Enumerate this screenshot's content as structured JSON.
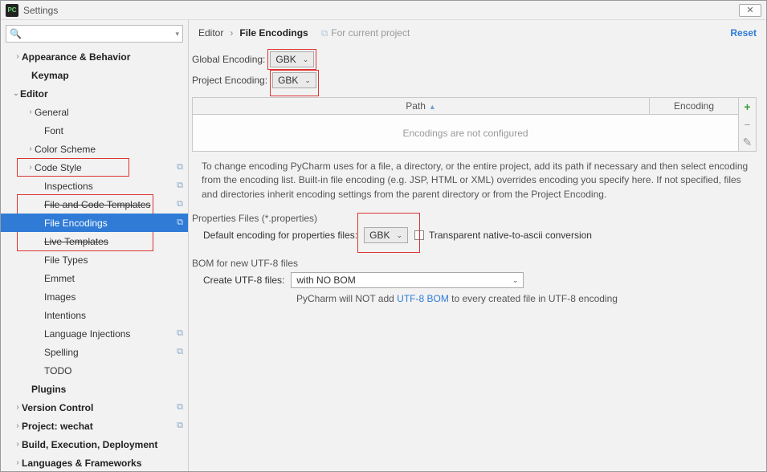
{
  "window": {
    "title": "Settings"
  },
  "sidebar": {
    "search_placeholder": "",
    "items": [
      {
        "label": "Appearance & Behavior",
        "bold": true,
        "arrow": "›",
        "indent": 16
      },
      {
        "label": "Keymap",
        "bold": true,
        "arrow": "",
        "indent": 28
      },
      {
        "label": "Editor",
        "bold": true,
        "arrow": "⌄",
        "indent": 14
      },
      {
        "label": "General",
        "arrow": "›",
        "indent": 32
      },
      {
        "label": "Font",
        "arrow": "",
        "indent": 44
      },
      {
        "label": "Color Scheme",
        "arrow": "›",
        "indent": 32
      },
      {
        "label": "Code Style",
        "arrow": "›",
        "indent": 32,
        "copy": true,
        "red": true
      },
      {
        "label": "Inspections",
        "arrow": "",
        "indent": 44,
        "copy": true
      },
      {
        "label": "File and Code Templates",
        "arrow": "",
        "indent": 44,
        "copy": true,
        "strike": true
      },
      {
        "label": "File Encodings",
        "arrow": "",
        "indent": 44,
        "copy": true,
        "sel": true
      },
      {
        "label": "Live Templates",
        "arrow": "",
        "indent": 44,
        "strike": true
      },
      {
        "label": "File Types",
        "arrow": "",
        "indent": 44
      },
      {
        "label": "Emmet",
        "arrow": "",
        "indent": 44
      },
      {
        "label": "Images",
        "arrow": "",
        "indent": 44
      },
      {
        "label": "Intentions",
        "arrow": "",
        "indent": 44
      },
      {
        "label": "Language Injections",
        "arrow": "",
        "indent": 44,
        "copy": true
      },
      {
        "label": "Spelling",
        "arrow": "",
        "indent": 44,
        "copy": true
      },
      {
        "label": "TODO",
        "arrow": "",
        "indent": 44
      },
      {
        "label": "Plugins",
        "bold": true,
        "arrow": "",
        "indent": 28
      },
      {
        "label": "Version Control",
        "bold": true,
        "arrow": "›",
        "indent": 16,
        "copy": true
      },
      {
        "label": "Project: wechat",
        "bold": true,
        "arrow": "›",
        "indent": 16,
        "copy": true
      },
      {
        "label": "Build, Execution, Deployment",
        "bold": true,
        "arrow": "›",
        "indent": 16
      },
      {
        "label": "Languages & Frameworks",
        "bold": true,
        "arrow": "›",
        "indent": 16
      }
    ]
  },
  "crumbs": {
    "c1": "Editor",
    "c2": "File Encodings",
    "hint": "For current project",
    "reset": "Reset"
  },
  "form": {
    "global_label": "Global Encoding:",
    "global_value": "GBK",
    "project_label": "Project Encoding:",
    "project_value": "GBK"
  },
  "paths": {
    "col_path": "Path",
    "col_enc": "Encoding",
    "empty": "Encodings are not configured"
  },
  "desc": "To change encoding PyCharm uses for a file, a directory, or the entire project, add its path if necessary and then select encoding from the encoding list. Built-in file encoding (e.g. JSP, HTML or XML) overrides encoding you specify here. If not specified, files and directories inherit encoding settings from the parent directory or from the Project Encoding.",
  "props": {
    "section": "Properties Files (*.properties)",
    "label": "Default encoding for properties files:",
    "value": "GBK",
    "check": "Transparent native-to-ascii conversion"
  },
  "bom": {
    "section": "BOM for new UTF-8 files",
    "label": "Create UTF-8 files:",
    "value": "with NO BOM",
    "note_pre": "PyCharm will NOT add ",
    "note_link": "UTF-8 BOM",
    "note_post": " to every created file in UTF-8 encoding"
  }
}
